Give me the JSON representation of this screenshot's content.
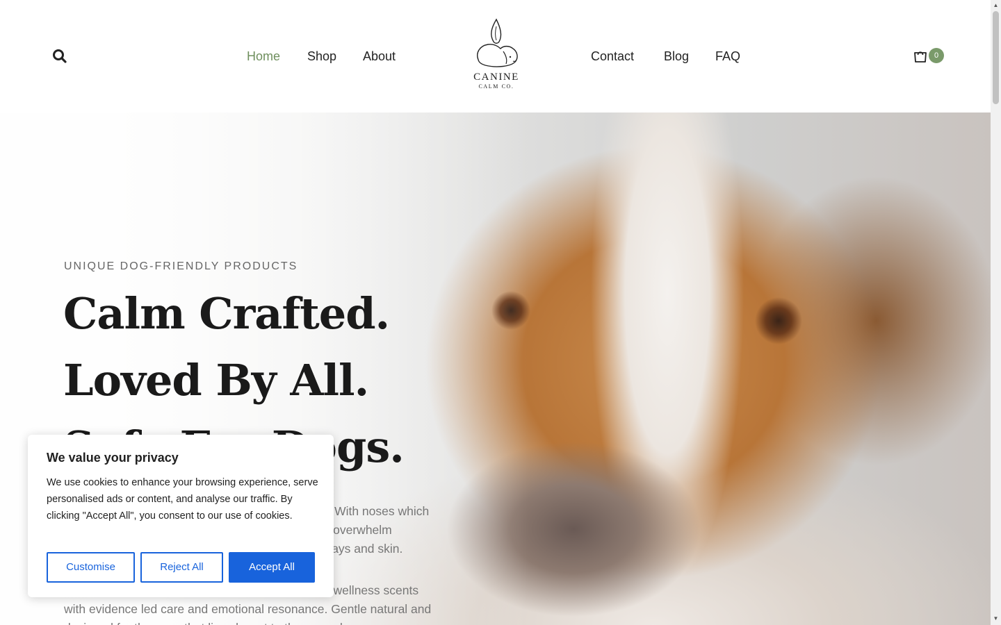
{
  "header": {
    "nav_left": [
      {
        "label": "Home",
        "active": true
      },
      {
        "label": "Shop",
        "active": false
      },
      {
        "label": "About",
        "active": false
      }
    ],
    "nav_right": [
      {
        "label": "Contact"
      },
      {
        "label": "Blog"
      },
      {
        "label": "FAQ"
      }
    ],
    "logo": {
      "main": "CANINE",
      "sub": "CALM CO."
    },
    "cart_count": "0",
    "accent_color": "#6f8f5e"
  },
  "hero": {
    "eyebrow": "UNIQUE DOG-FRIENDLY PRODUCTS",
    "headline": [
      "Calm Crafted.",
      "Loved By All.",
      "Safe For Dogs."
    ],
    "paragraph1_lines": [
      "Most candles are made with synthetic fragrances. With noses which",
      "are far more sensitive than our own, these scents overwhelm",
      "dogs, cause stress and can even irritate their airways and skin."
    ],
    "paragraph2_lines": [
      "At Canine Calm Co, we're bringing ultimate home wellness scents",
      "with evidence led care and emotional resonance. Gentle natural and",
      "designed for the ones that live closest to the ground."
    ]
  },
  "cookie_banner": {
    "title": "We value your privacy",
    "text": "We use cookies to enhance your browsing experience, serve personalised ads or content, and analyse our traffic. By clicking \"Accept All\", you consent to our use of cookies.",
    "customise_label": "Customise",
    "reject_label": "Reject All",
    "accept_label": "Accept All",
    "button_color": "#1863dc"
  }
}
